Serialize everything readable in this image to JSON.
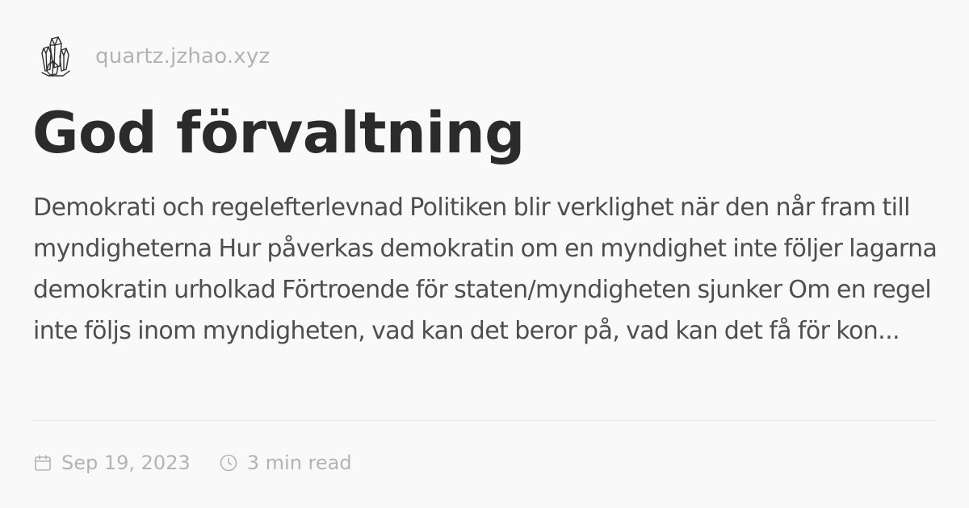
{
  "site": {
    "logo_icon": "crystal-cluster-icon",
    "url": "quartz.jzhao.xyz"
  },
  "article": {
    "title": "God förvaltning",
    "excerpt": "Demokrati och regelefterlevnad Politiken blir verklighet när den når fram till myndigheterna Hur påverkas demokratin om en myndighet inte följer lagarna demokratin urholkad Förtroende för staten/myndigheten sjunker Om en regel inte följs inom myndigheten, vad kan det beror på, vad kan det få för kon...",
    "date": "Sep 19, 2023",
    "date_icon": "calendar-icon",
    "reading_time": "3 min read",
    "reading_time_icon": "clock-icon"
  },
  "colors": {
    "background": "#faf9fa",
    "title": "#2b2b2b",
    "body_text": "#4e4e4e",
    "muted_text": "#b4b2b4",
    "divider": "#e8e6e8"
  }
}
